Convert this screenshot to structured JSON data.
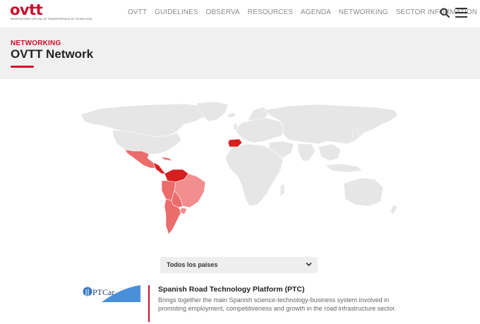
{
  "brand": {
    "wordmark": "ovtt",
    "tagline": "OBSERVATORIO VIRTUAL DE TRANSFERENCIA DE TECNOLOGÍA",
    "color": "#c8102e"
  },
  "nav": {
    "items": [
      {
        "label": "OVTT"
      },
      {
        "label": "GUIDELINES"
      },
      {
        "label": "OBSERVA"
      },
      {
        "label": "RESOURCES"
      },
      {
        "label": "AGENDA"
      },
      {
        "label": "NETWORKING"
      },
      {
        "label": "SECTOR INFORMATION"
      }
    ],
    "search_icon": "search-icon",
    "menu_icon": "hamburger-menu-icon"
  },
  "hero": {
    "eyebrow": "NETWORKING",
    "title": "OVTT Network"
  },
  "map": {
    "land_color": "#e6e6e6",
    "highlight_light": "#f28e8e",
    "highlight_mid": "#ec6b6b",
    "highlight_strong": "#d71f1f",
    "highlighted_countries": [
      "Mexico",
      "Guatemala",
      "Colombia",
      "Venezuela",
      "Ecuador",
      "Peru",
      "Brazil",
      "Bolivia",
      "Paraguay",
      "Chile",
      "Argentina",
      "Uruguay",
      "Cuba",
      "Spain"
    ]
  },
  "filter": {
    "selected": "Todos los países"
  },
  "entry": {
    "logo_text": "PTCar",
    "title": "Spanish Road Technology Platform (PTC)",
    "description": "Brings together the main Spanish science-technology-business system involved in promoting employment, competitiveness and growth in the road infrastructure sector."
  }
}
